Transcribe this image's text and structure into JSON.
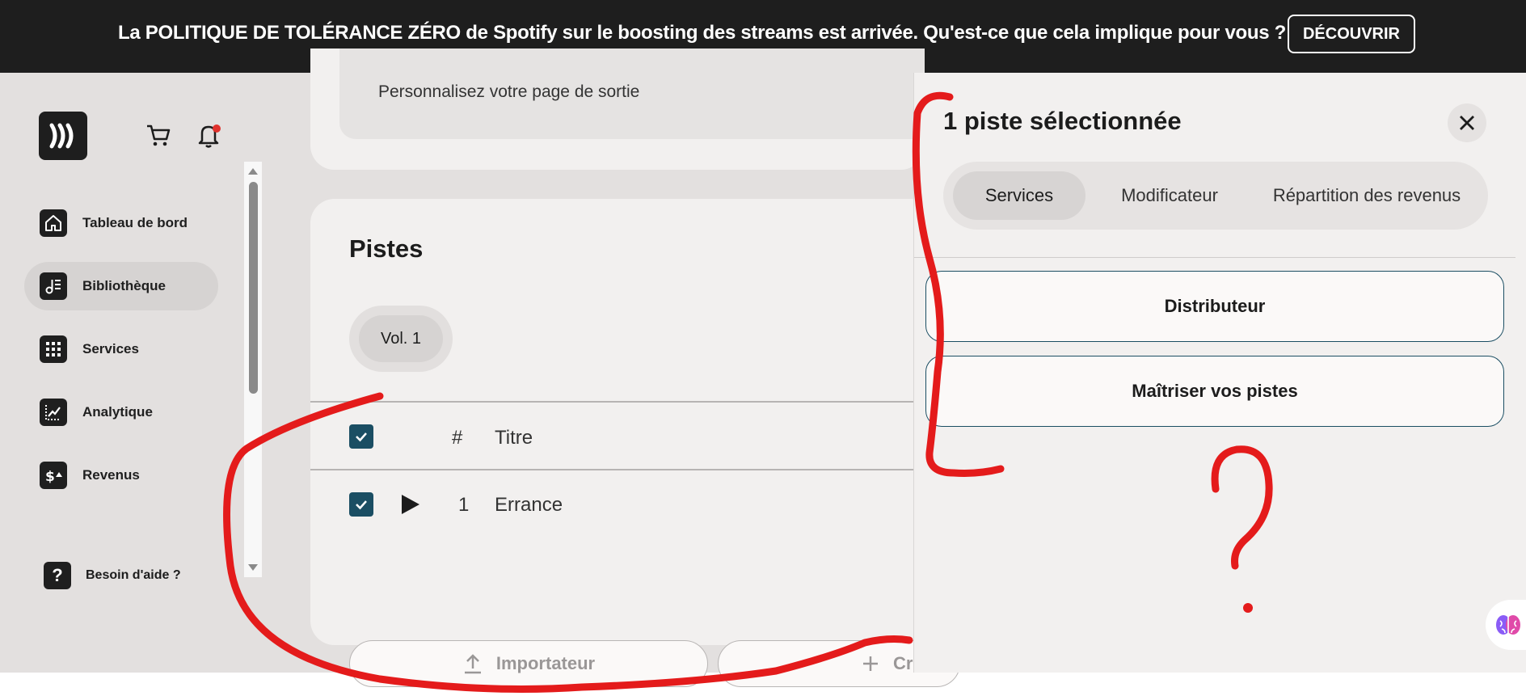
{
  "banner": {
    "text": "La POLITIQUE DE TOLÉRANCE ZÉRO de Spotify sur le boosting des streams est arrivée. Qu'est-ce que cela implique pour vous ?",
    "button_label": "DÉCOUVRIR"
  },
  "sidebar": {
    "items": [
      {
        "label": "Tableau de bord",
        "icon": "home-icon"
      },
      {
        "label": "Bibliothèque",
        "icon": "library-icon",
        "active": true
      },
      {
        "label": "Services",
        "icon": "grid-icon"
      },
      {
        "label": "Analytique",
        "icon": "analytics-icon"
      },
      {
        "label": "Revenus",
        "icon": "revenue-icon"
      }
    ],
    "help_label": "Besoin d'aide ?"
  },
  "upper_card": {
    "text": "Personnalisez votre page de sortie"
  },
  "tracks": {
    "title": "Pistes",
    "volume_label": "Vol. 1",
    "header": {
      "number": "#",
      "title": "Titre"
    },
    "rows": [
      {
        "number": "1",
        "title": "Errance",
        "checked": true
      }
    ],
    "import_label": "Importateur",
    "create_label": "Cr"
  },
  "panel": {
    "title": "1 piste sélectionnée",
    "tabs": [
      {
        "label": "Services",
        "active": true
      },
      {
        "label": "Modificateur"
      },
      {
        "label": "Répartition des revenus"
      }
    ],
    "options": [
      {
        "label": "Distributeur"
      },
      {
        "label": "Maîtriser vos pistes"
      }
    ]
  },
  "colors": {
    "banner_bg": "#1e1e1e",
    "checkbox": "#1b4e63",
    "annotation": "#e41b1b"
  }
}
